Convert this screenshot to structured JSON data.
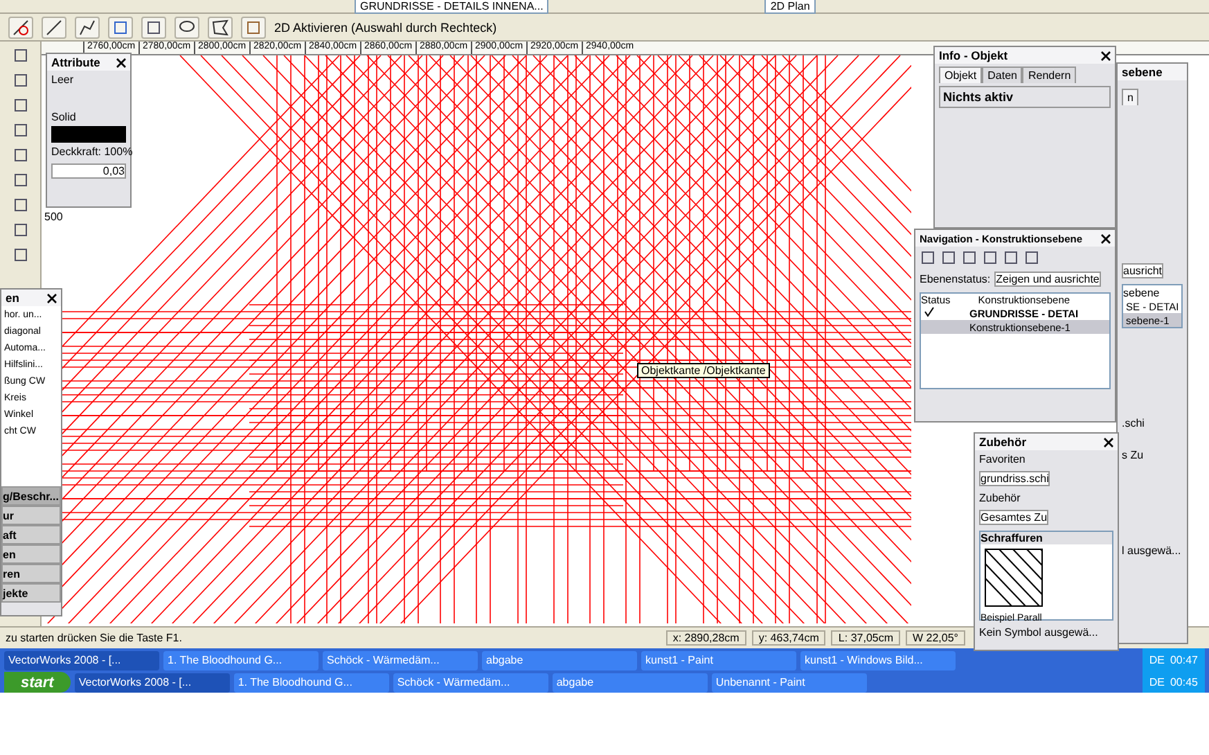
{
  "toolbar": {
    "layer_field": "GRUNDRISSE - DETAILS INNENA...",
    "view_field": "2D Plan",
    "hint": "2D Aktivieren (Auswahl durch Rechteck)"
  },
  "ruler": {
    "ticks": [
      "2760,00cm",
      "2780,00cm",
      "2800,00cm",
      "2820,00cm",
      "2840,00cm",
      "2860,00cm",
      "2880,00cm",
      "2900,00cm",
      "2920,00cm",
      "2940,00cm"
    ],
    "side_label": "500"
  },
  "tooltip": "Objektkante /Objektkante",
  "attribute_palette": {
    "title": "Attribute",
    "fill_label": "Leer",
    "pen_label": "Solid",
    "opacity": "Deckkraft: 100%",
    "thickness": "0,03"
  },
  "left_palette": {
    "title": "en",
    "items": [
      "hor. un...",
      "diagonal",
      "Automa...",
      "Hilfslini...",
      "ßung CW",
      "Kreis",
      "Winkel",
      "cht CW"
    ],
    "groups": [
      {
        "label": "g/Beschr...",
        "selected": true
      },
      {
        "label": "ur",
        "selected": false
      },
      {
        "label": "aft",
        "selected": false
      },
      {
        "label": "en",
        "selected": false
      },
      {
        "label": "ren",
        "selected": false
      },
      {
        "label": "jekte",
        "selected": false
      }
    ]
  },
  "info_palette": {
    "title": "Info - Objekt",
    "tabs": [
      {
        "label": "Objekt",
        "selected": true
      },
      {
        "label": "Daten",
        "selected": false
      },
      {
        "label": "Rendern",
        "selected": false
      }
    ],
    "status": "Nichts aktiv"
  },
  "navigation_palette": {
    "title": "Navigation - Konstruktionsebene",
    "status_label": "Ebenenstatus:",
    "status_value": "Zeigen und ausrichte",
    "columns": [
      "Status",
      "Konstruktionsebene"
    ],
    "layers": [
      {
        "name": "GRUNDRISSE - DETAI",
        "active": true,
        "selected": false
      },
      {
        "name": "Konstruktionsebene-1",
        "active": false,
        "selected": true
      }
    ]
  },
  "back_palette": {
    "title": "sebene",
    "tab_fragment": "n",
    "status_value": "ausricht",
    "column": "sebene",
    "layers": [
      {
        "name": "SE - DETAI",
        "selected": false
      },
      {
        "name": "sebene-1",
        "selected": true
      }
    ],
    "field": ".schi",
    "field2": "s Zu",
    "footer": "l ausgewä..."
  },
  "zubehoer_palette": {
    "title": "Zubehör",
    "favorites_label": "Favoriten",
    "favorites_value": "grundriss.schi",
    "library_label": "Zubehör",
    "library_value": "Gesamtes Zu",
    "section": "Schraffuren",
    "item_caption": "Beispiel Parall",
    "footer": "Kein Symbol ausgewä..."
  },
  "status_bar": {
    "help": "zu starten drücken Sie die Taste F1.",
    "fields": [
      "x: 2890,28cm",
      "y: 463,74cm",
      "L: 37,05cm",
      "W 22,05°"
    ]
  },
  "taskbar": {
    "buttons": [
      {
        "label": "VectorWorks 2008 - [...",
        "selected": true
      },
      {
        "label": "1. The Bloodhound G...",
        "selected": false
      },
      {
        "label": "Schöck - Wärmedäm...",
        "selected": false
      },
      {
        "label": "abgabe",
        "selected": false
      },
      {
        "label": "kunst1 - Paint",
        "selected": false
      },
      {
        "label": "kunst1 - Windows Bild...",
        "selected": false
      }
    ],
    "language": "DE",
    "clock": "00:47"
  },
  "taskbar_lower": {
    "start": "start",
    "buttons": [
      {
        "label": "VectorWorks 2008 - [...",
        "selected": true
      },
      {
        "label": "1. The Bloodhound G...",
        "selected": false
      },
      {
        "label": "Schöck - Wärmedäm...",
        "selected": false
      },
      {
        "label": "abgabe",
        "selected": false
      },
      {
        "label": "Unbenannt - Paint",
        "selected": false
      }
    ],
    "language": "DE",
    "clock": "00:45"
  }
}
